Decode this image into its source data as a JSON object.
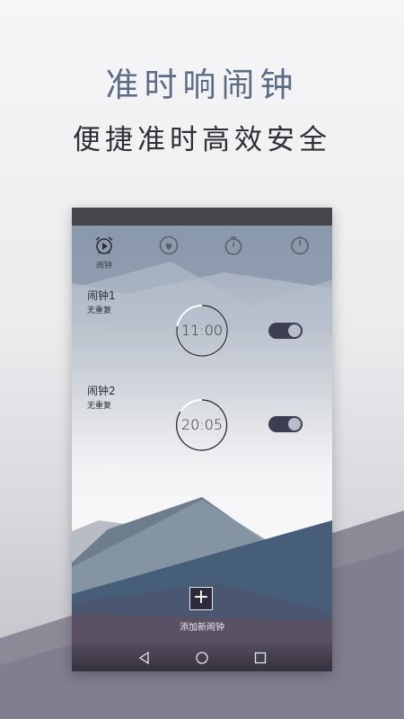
{
  "hero": {
    "title": "准时响闹钟",
    "subtitle": "便捷准时高效安全"
  },
  "colors": {
    "accent": "#5c6c84",
    "toggle_on": "#3e3e52",
    "status_bar": "#45454c"
  },
  "tabs": [
    {
      "label": "闹钟",
      "icon": "alarm-clock-icon",
      "active": true
    },
    {
      "label": "",
      "icon": "heart-clock-icon",
      "active": false
    },
    {
      "label": "",
      "icon": "stopwatch-icon",
      "active": false
    },
    {
      "label": "",
      "icon": "timer-icon",
      "active": false
    }
  ],
  "alarms": [
    {
      "name": "闹钟1",
      "repeat": "无重复",
      "time": "11:00",
      "enabled": true
    },
    {
      "name": "闹钟2",
      "repeat": "无重复",
      "time": "20:05",
      "enabled": true
    }
  ],
  "add_alarm": {
    "icon": "plus-icon",
    "label": "添加新闹钟"
  },
  "nav": {
    "back": "back-triangle-icon",
    "home": "home-circle-icon",
    "recents": "recents-square-icon"
  }
}
